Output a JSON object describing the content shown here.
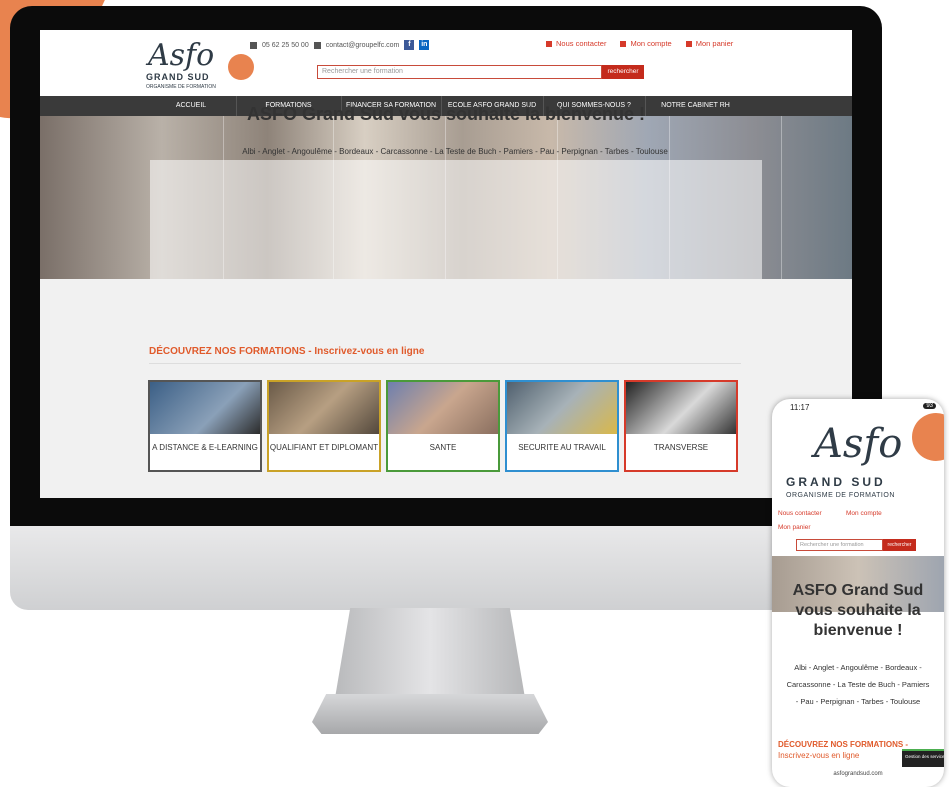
{
  "header": {
    "logo_script": "Asfo",
    "logo_grand": "GRAND SUD",
    "logo_tag": "ORGANISME DE FORMATION",
    "phone": "05 62 25 50 00",
    "email": "contact@groupelfc.com",
    "links": [
      "Nous contacter",
      "Mon compte",
      "Mon panier"
    ],
    "search_placeholder": "Rechercher une formation",
    "search_button": "rechercher"
  },
  "nav": [
    "ACCUEIL",
    "FORMATIONS",
    "FINANCER SA FORMATION",
    "ECOLE ASFO GRAND SUD",
    "QUI SOMMES-NOUS ?",
    "NOTRE CABINET RH"
  ],
  "hero": {
    "title": "ASFO Grand Sud vous souhaite la bienvenue !",
    "cities": "Albi - Anglet - Angoulême - Bordeaux - Carcassonne - La Teste de Buch - Pamiers - Pau - Perpignan - Tarbes - Toulouse"
  },
  "formations": {
    "title": "DÉCOUVREZ NOS FORMATIONS - Inscrivez-vous en ligne",
    "cards": [
      {
        "label": "A DISTANCE & E-LEARNING",
        "color": "#555555"
      },
      {
        "label": "QUALIFIANT ET DIPLOMANT",
        "color": "#c9a227"
      },
      {
        "label": "SANTE",
        "color": "#4a9a3a"
      },
      {
        "label": "SECURITE AU TRAVAIL",
        "color": "#2f8fd0"
      },
      {
        "label": "TRANSVERSE",
        "color": "#d63a2a"
      }
    ]
  },
  "phone": {
    "time": "11:17",
    "battery": "93",
    "hero_title": "ASFO Grand Sud vous souhaite la bienvenue !",
    "cities": "Albi - Anglet - Angoulême - Bordeaux - Carcassonne - La Teste de Buch - Pamiers - Pau - Perpignan - Tarbes - Toulouse",
    "section_title": "DÉCOUVREZ NOS FORMATIONS -",
    "section_sub": "Inscrivez-vous en ligne",
    "gdpr": "Gestion des services",
    "url": "asfograndsud.com"
  },
  "colors": {
    "accent": "#d63a2a",
    "brand_orange": "#e8834f",
    "nav_bg": "#3a3a3a"
  }
}
